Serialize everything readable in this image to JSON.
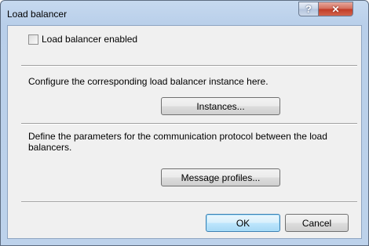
{
  "window": {
    "title": "Load balancer"
  },
  "titlebar": {
    "help_glyph": "?",
    "close_glyph": "✕"
  },
  "options": {
    "enabled_label": "Load balancer enabled",
    "enabled_checked": false
  },
  "instance_section": {
    "description": "Configure the corresponding load balancer instance here.",
    "button_label": "Instances..."
  },
  "protocol_section": {
    "description": "Define the parameters for the communication protocol between the load balancers.",
    "button_label": "Message profiles..."
  },
  "footer": {
    "ok_label": "OK",
    "cancel_label": "Cancel"
  },
  "icons": [
    "help-icon",
    "close-icon"
  ],
  "colors": {
    "close_red": "#c13b26",
    "default_button_border": "#3c7fb1",
    "client_bg": "#f0f0f0"
  }
}
